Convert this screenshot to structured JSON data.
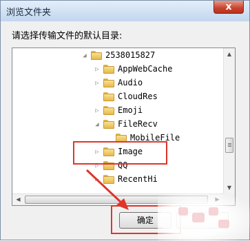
{
  "window": {
    "title": "浏览文件夹",
    "close_label": "x"
  },
  "prompt": "请选择传输文件的默认目录:",
  "tree": {
    "items": [
      {
        "label": "2538015827",
        "expander": "expanded"
      },
      {
        "label": "AppWebCache",
        "expander": "collapsed"
      },
      {
        "label": "Audio",
        "expander": "collapsed"
      },
      {
        "label": "CloudRes",
        "expander": "none"
      },
      {
        "label": "Emoji",
        "expander": "collapsed"
      },
      {
        "label": "FileRecv",
        "expander": "expanded"
      },
      {
        "label": "MobileFile",
        "expander": "none"
      },
      {
        "label": "Image",
        "expander": "collapsed",
        "selected": true
      },
      {
        "label": "QQ",
        "expander": "collapsed"
      },
      {
        "label": "RecentHi",
        "expander": "collapsed"
      }
    ]
  },
  "buttons": {
    "ok_label": "确定",
    "cancel_label": ""
  },
  "colors": {
    "annotation_red": "#e0342a",
    "folder_yellow": "#e8b94a"
  }
}
